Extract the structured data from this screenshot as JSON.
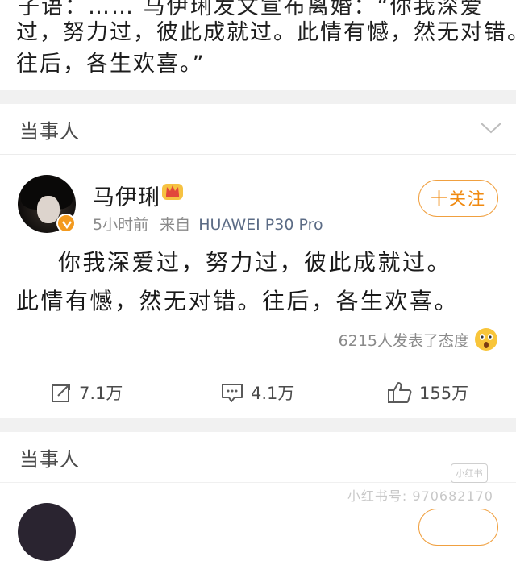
{
  "top_quote": {
    "line1": "过，努力过，彼此成就过。此情有憾，然无对错。",
    "line2": "往后，各生欢喜。”"
  },
  "section1": {
    "title": "当事人"
  },
  "post": {
    "username": "马伊琍",
    "time": "5小时前",
    "from_label": "来自",
    "source": "HUAWEI P30 Pro",
    "follow_label": "十关注",
    "text_line1": "你我深爱过，努力过，彼此成就过。",
    "text_line2": "此情有憾，然无对错。往后，各生欢喜。",
    "reaction_text": "6215人发表了态度",
    "actions": {
      "repost": "7.1万",
      "comment": "4.1万",
      "like": "155万"
    }
  },
  "section2": {
    "title": "当事人"
  },
  "watermark": {
    "logo": "小红书",
    "text": "小红书号: 970682170"
  },
  "colors": {
    "accent": "#f08a10",
    "divider_bg": "#f1f1f1",
    "source_link": "#5b6b85"
  },
  "icons": [
    "chevron-down-icon",
    "verified-badge-icon",
    "vip-crown-icon",
    "wow-emoji-icon",
    "repost-icon",
    "comment-icon",
    "like-icon"
  ]
}
